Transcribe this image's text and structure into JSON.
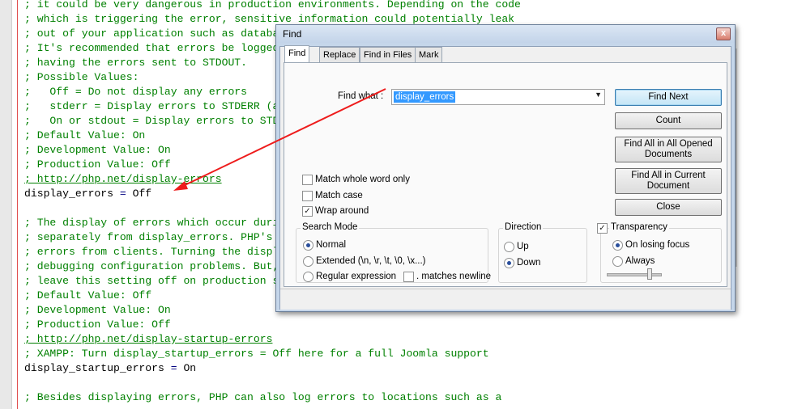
{
  "editor": {
    "lines": [
      {
        "text": "; it could be very dangerous in production environments. Depending on the code"
      },
      {
        "text": "; which is triggering the error, sensitive information could potentially leak"
      },
      {
        "text": "; out of your application such as database usernames and passwords or worse."
      },
      {
        "text": "; It's recommended that errors be logged on production servers rather than"
      },
      {
        "text": "; having the errors sent to STDOUT."
      },
      {
        "text": "; Possible Values:"
      },
      {
        "text": ";   Off = Do not display any errors"
      },
      {
        "text": ";   stderr = Display errors to STDERR (affects only CGI/CLI binaries!)"
      },
      {
        "text": ";   On or stdout = Display errors to STDOUT"
      },
      {
        "text": "; Default Value: On"
      },
      {
        "text": "; Development Value: On"
      },
      {
        "text": "; Production Value: Off"
      },
      {
        "text": "; http://php.net/display-errors"
      },
      {
        "key": "display_errors",
        "op": "=",
        "value": "Off"
      },
      {
        "text": ""
      },
      {
        "text": "; The display of errors which occur during PHP's startup sequence are handled"
      },
      {
        "text": "; separately from display_errors. PHP's default behavior is to suppress those"
      },
      {
        "text": "; errors from clients. Turning the display of startup errors on can be useful in"
      },
      {
        "text": "; debugging configuration problems. But, it's strongly recommended that you"
      },
      {
        "text": "; leave this setting off on production servers."
      },
      {
        "text": "; Default Value: Off"
      },
      {
        "text": "; Development Value: On"
      },
      {
        "text": "; Production Value: Off"
      },
      {
        "text": "; http://php.net/display-startup-errors"
      },
      {
        "text": "; XAMPP: Turn display_startup_errors = Off here for a full Joomla support"
      },
      {
        "key": "display_startup_errors",
        "op": "=",
        "value": "On"
      },
      {
        "text": ""
      },
      {
        "text": "; Besides displaying errors, PHP can also log errors to locations such as a"
      }
    ]
  },
  "dialog": {
    "title": "Find",
    "close_glyph": "x",
    "tabs": [
      {
        "label": "Find"
      },
      {
        "label": "Replace"
      },
      {
        "label": "Find in Files"
      },
      {
        "label": "Mark"
      }
    ],
    "find_what_label": "Find what :",
    "find_what_value": "display_errors",
    "combo_arrow": "▼",
    "buttons": {
      "find_next": "Find Next",
      "count": "Count",
      "find_all_opened": "Find All in All Opened Documents",
      "find_all_current": "Find All in Current Document",
      "close": "Close"
    },
    "options": {
      "match_whole_word": "Match whole word only",
      "match_case": "Match case",
      "wrap_around": "Wrap around",
      "check_glyph": "✓"
    },
    "search_mode": {
      "title": "Search Mode",
      "normal": "Normal",
      "extended": "Extended (\\n, \\r, \\t, \\0, \\x...)",
      "regex": "Regular expression",
      "matches_newline": ". matches newline"
    },
    "direction": {
      "title": "Direction",
      "up": "Up",
      "down": "Down"
    },
    "transparency": {
      "title": "Transparency",
      "on_losing_focus": "On losing focus",
      "always": "Always"
    }
  }
}
